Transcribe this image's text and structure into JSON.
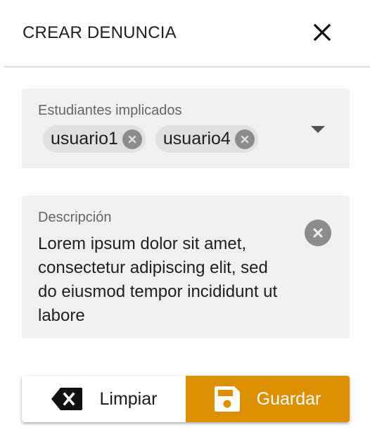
{
  "header": {
    "title": "CREAR DENUNCIA",
    "close_icon": "close-icon"
  },
  "students_field": {
    "label": "Estudiantes implicados",
    "chips": [
      {
        "label": "usuario1"
      },
      {
        "label": "usuario4"
      }
    ],
    "dropdown_icon": "arrow-drop-down-icon"
  },
  "description_field": {
    "label": "Descripción",
    "value": "Lorem ipsum dolor sit amet, consectetur adipiscing elit, sed do eiusmod tempor incididunt ut labore",
    "clear_icon": "clear-circle-icon"
  },
  "actions": {
    "clear_label": "Limpiar",
    "clear_icon": "backspace-icon",
    "save_label": "Guardar",
    "save_icon": "save-icon"
  },
  "colors": {
    "accent": "#dc8f00",
    "field_bg": "#f0f0f0",
    "chip_bg": "#e0e0e0",
    "icon_gray": "#8c8c8c"
  }
}
